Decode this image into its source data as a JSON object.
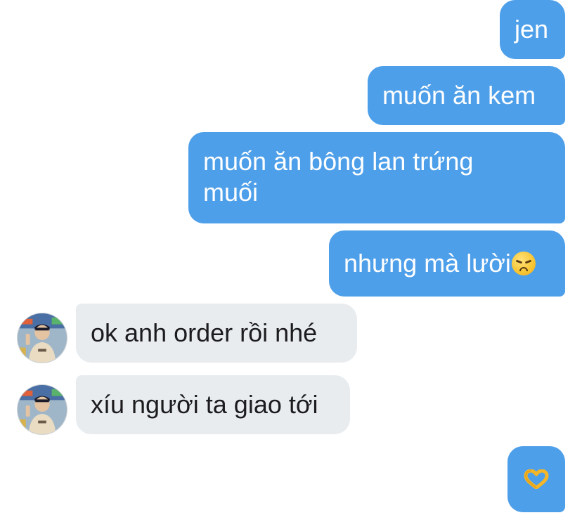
{
  "messages": [
    {
      "direction": "sent",
      "text": "jen"
    },
    {
      "direction": "sent",
      "text": "muốn ăn kem"
    },
    {
      "direction": "sent",
      "text": "muốn ăn bông lan trứng\nmuối"
    },
    {
      "direction": "sent",
      "text": "nhưng mà lười",
      "emoji": "disappointed-face-icon"
    },
    {
      "direction": "received",
      "text": "ok anh order rồi nhé"
    },
    {
      "direction": "received",
      "text": "xíu người ta giao tới"
    },
    {
      "direction": "sent",
      "emoji": "heart-hands-icon"
    }
  ],
  "colors": {
    "sent_bubble": "#4e9fe9",
    "received_bubble": "#e9ecef",
    "sent_text": "#ffffff",
    "received_text": "#1c1c1e"
  }
}
